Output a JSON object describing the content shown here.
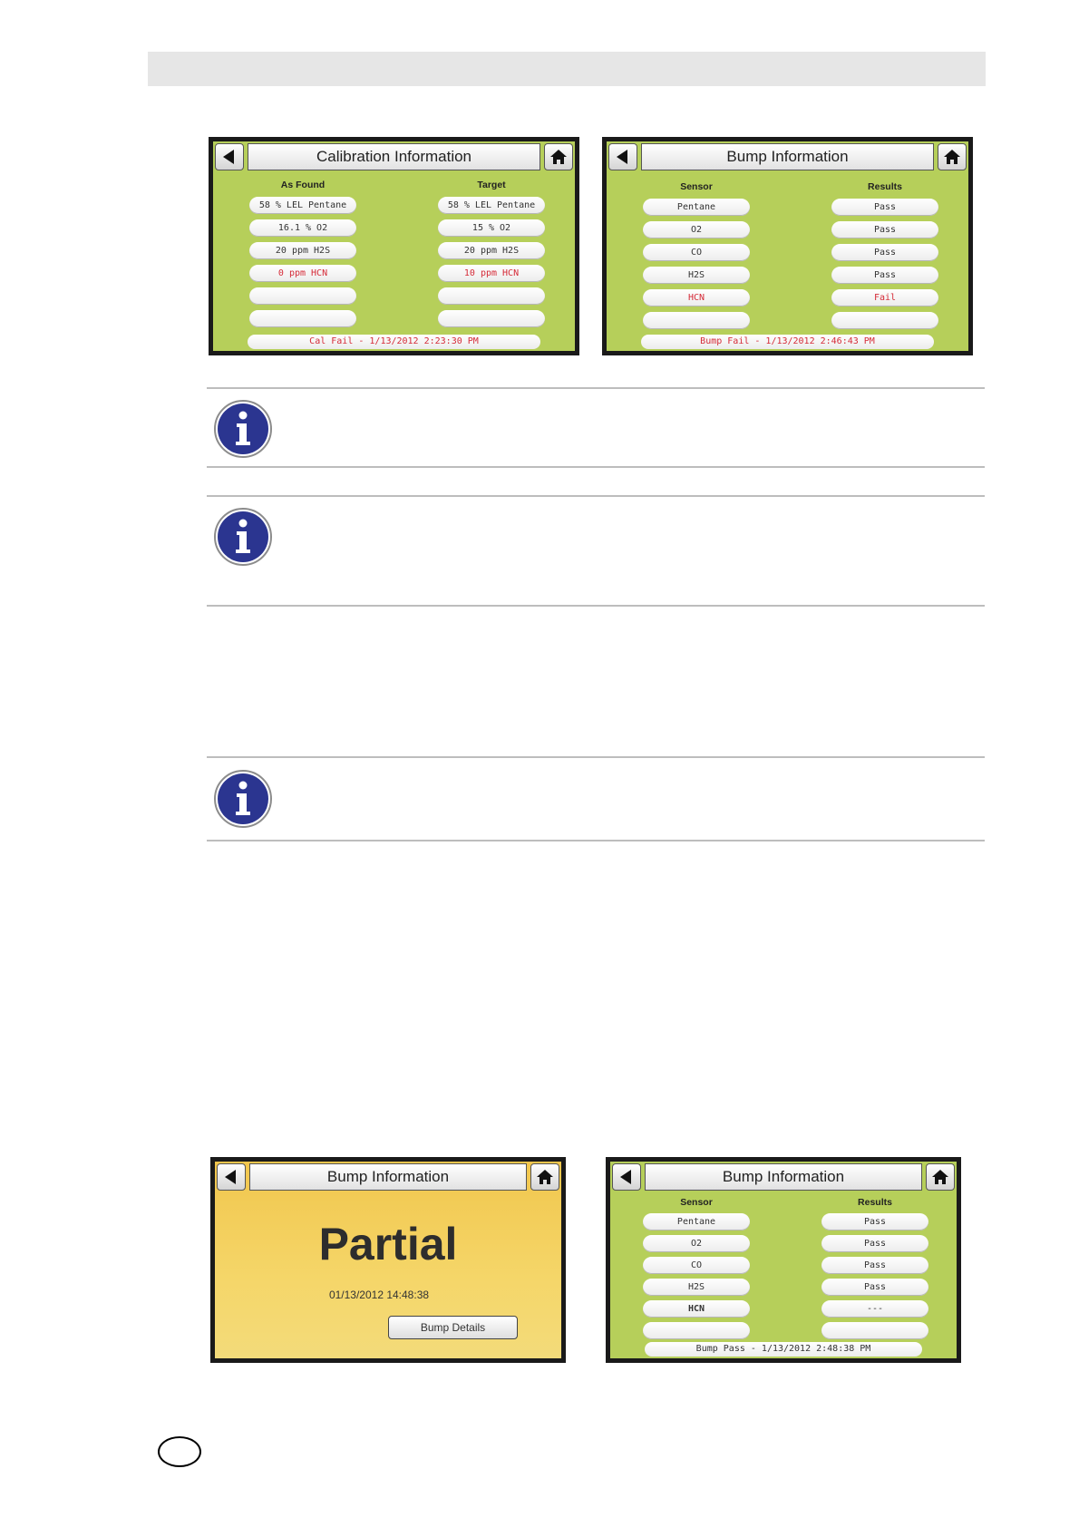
{
  "screen1": {
    "title": "Calibration Information",
    "col_left": "As Found",
    "col_right": "Target",
    "rows": [
      {
        "left": "58 % LEL Pentane",
        "right": "58 % LEL Pentane"
      },
      {
        "left": "16.1 % O2",
        "right": "15 % O2"
      },
      {
        "left": "20 ppm H2S",
        "right": "20 ppm H2S"
      },
      {
        "left": "0 ppm HCN",
        "right": "10 ppm HCN"
      },
      {
        "left": "",
        "right": ""
      },
      {
        "left": "",
        "right": ""
      }
    ],
    "status": "Cal Fail - 1/13/2012 2:23:30 PM"
  },
  "screen2": {
    "title": "Bump Information",
    "col_left": "Sensor",
    "col_right": "Results",
    "rows": [
      {
        "left": "Pentane",
        "right": "Pass"
      },
      {
        "left": "O2",
        "right": "Pass"
      },
      {
        "left": "CO",
        "right": "Pass"
      },
      {
        "left": "H2S",
        "right": "Pass"
      },
      {
        "left": "HCN",
        "right": "Fail"
      },
      {
        "left": "",
        "right": ""
      }
    ],
    "status": "Bump Fail - 1/13/2012 2:46:43 PM"
  },
  "screen3": {
    "title": "Bump Information",
    "result": "Partial",
    "date": "01/13/2012 14:48:38",
    "button": "Bump Details"
  },
  "screen4": {
    "title": "Bump Information",
    "col_left": "Sensor",
    "col_right": "Results",
    "rows": [
      {
        "left": "Pentane",
        "right": "Pass"
      },
      {
        "left": "O2",
        "right": "Pass"
      },
      {
        "left": "CO",
        "right": "Pass"
      },
      {
        "left": "H2S",
        "right": "Pass"
      },
      {
        "left": "HCN",
        "right": "---"
      },
      {
        "left": "",
        "right": ""
      }
    ],
    "status": "Bump Pass - 1/13/2012 2:48:38 PM"
  },
  "colors": {
    "screen_green": "#b6cf5a",
    "screen_yellow": "#f3d060",
    "fail_red": "#d52b38",
    "info_blue": "#2b3590"
  },
  "icons": [
    "back-arrow-icon",
    "home-icon",
    "info-icon"
  ]
}
